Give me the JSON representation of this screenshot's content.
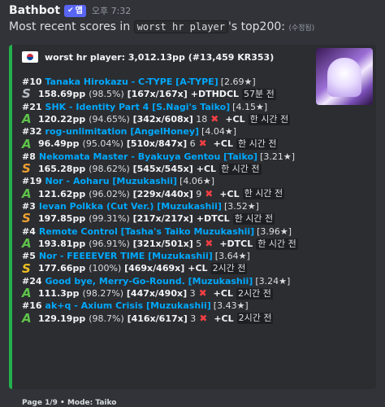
{
  "header": {
    "bot_name": "Bathbot",
    "app_badge": "앱",
    "timestamp": "오후 7:32"
  },
  "message": {
    "prefix": "Most recent scores in ",
    "code": "worst hr player",
    "suffix": "'s top200:",
    "edited": "(수정됨)"
  },
  "embed": {
    "accent_color": "#22b14c",
    "author": "worst hr player: 3,012.13pp (#13,459 KR353)",
    "flag_icon": "south-korea-flag",
    "footer": "Page 1/9 • Mode: Taiko",
    "scores": [
      {
        "rank": "#10",
        "title": "Tanaka Hirokazu - C-TYPE [A-TYPE]",
        "stars": "[2.69★]",
        "grade": "S",
        "grade_color": "#b8bcc4",
        "pp": "158.69pp",
        "acc": "(98.5%)",
        "combo": "[167x/167x]",
        "misses": "",
        "mods": "+DTHDCL",
        "time": "57분 전"
      },
      {
        "rank": "#21",
        "title": "SHK - Identity Part 4 [S.Nagi's Taiko]",
        "stars": "[4.15★]",
        "grade": "A",
        "grade_color": "#5fc34a",
        "pp": "120.22pp",
        "acc": "(94.65%)",
        "combo": "[342x/608x]",
        "misses": "18",
        "mods": "+CL",
        "time": "한 시간 전"
      },
      {
        "rank": "#32",
        "title": "rog-unlimitation [AngelHoney]",
        "stars": "[4.04★]",
        "grade": "A",
        "grade_color": "#5fc34a",
        "pp": "96.49pp",
        "acc": "(95.04%)",
        "combo": "[510x/847x]",
        "misses": "6",
        "mods": "+CL",
        "time": "한 시간 전"
      },
      {
        "rank": "#8",
        "title": "Nekomata Master - Byakuya Gentou [Taiko]",
        "stars": "[3.21★]",
        "grade": "S",
        "grade_color": "#f0a030",
        "pp": "165.28pp",
        "acc": "(98.62%)",
        "combo": "[545x/545x]",
        "misses": "",
        "mods": "+CL",
        "time": "한 시간 전"
      },
      {
        "rank": "#19",
        "title": "Nor - Aoharu [Muzukashii]",
        "stars": "[4.06★]",
        "grade": "A",
        "grade_color": "#5fc34a",
        "pp": "121.62pp",
        "acc": "(96.02%)",
        "combo": "[229x/440x]",
        "misses": "9",
        "mods": "+CL",
        "time": "한 시간 전"
      },
      {
        "rank": "#3",
        "title": "Ievan Polkka (Cut Ver.) [Muzukashii]",
        "stars": "[3.52★]",
        "grade": "S",
        "grade_color": "#f0a030",
        "pp": "197.85pp",
        "acc": "(99.31%)",
        "combo": "[217x/217x]",
        "misses": "",
        "mods": "+DTCL",
        "time": "한 시간 전"
      },
      {
        "rank": "#4",
        "title": "Remote Control [Tasha's Taiko Muzukashii]",
        "stars": "[3.96★]",
        "grade": "A",
        "grade_color": "#5fc34a",
        "pp": "193.81pp",
        "acc": "(96.91%)",
        "combo": "[321x/501x]",
        "misses": "5",
        "mods": "+DTCL",
        "time": "한 시간 전"
      },
      {
        "rank": "#5",
        "title": "Nor - FEEEEVER TIME [Muzukashii]",
        "stars": "[3.64★]",
        "grade": "S",
        "grade_color": "#f0c020",
        "pp": "177.66pp",
        "acc": "(100%)",
        "combo": "[469x/469x]",
        "misses": "",
        "mods": "+CL",
        "time": "2시간 전"
      },
      {
        "rank": "#24",
        "title": "Good bye, Merry-Go-Round. [Muzukashii]",
        "stars": "[3.24★]",
        "grade": "A",
        "grade_color": "#5fc34a",
        "pp": "111.3pp",
        "acc": "(98.27%)",
        "combo": "[447x/490x]",
        "misses": "3",
        "mods": "+CL",
        "time": "2시간 전"
      },
      {
        "rank": "#16",
        "title": "ak+q - Axium Crisis [Muzukashii]",
        "stars": "[3.43★]",
        "grade": "A",
        "grade_color": "#5fc34a",
        "pp": "129.19pp",
        "acc": "(98.7%)",
        "combo": "[416x/617x]",
        "misses": "3",
        "mods": "+CL",
        "time": "2시간 전"
      }
    ]
  }
}
